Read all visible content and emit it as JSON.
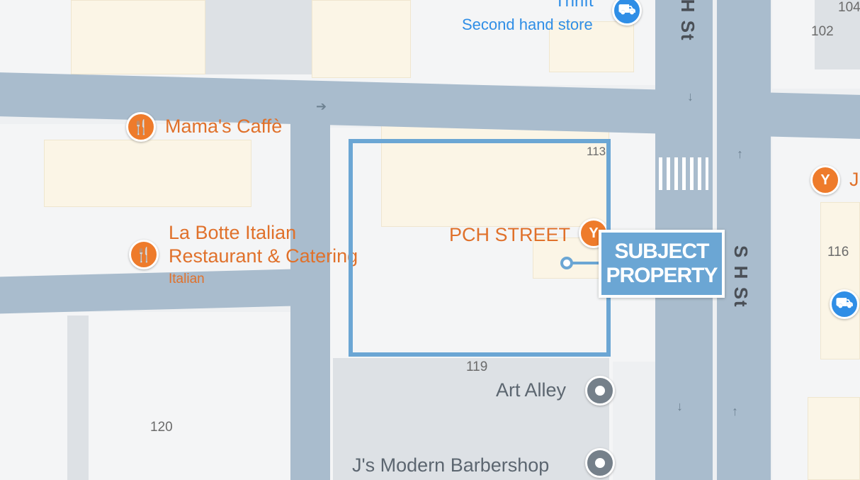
{
  "pois": {
    "thrift_name": "Thrift",
    "thrift_category": "Second hand store",
    "mamas": "Mama's Caffè",
    "labotte_line1": "La Botte Italian",
    "labotte_line2": "Restaurant & Catering",
    "labotte_category": "Italian",
    "pch": "PCH STREET",
    "art_alley": "Art Alley",
    "barbershop": "J's Modern Barbershop",
    "right_edge_letter": "J"
  },
  "streets": {
    "s_h_st": "S H St"
  },
  "lots": {
    "n102": "102",
    "n104": "104",
    "n113": "113",
    "n116": "116",
    "n119": "119",
    "n120": "120"
  },
  "subject": {
    "line1": "SUBJECT",
    "line2": "PROPERTY",
    "color": "#6ba6d4"
  },
  "icons": {
    "restaurant": "fork-knife-icon",
    "bar": "cocktail-icon",
    "shopping": "shopping-bag-icon",
    "place": "place-dot-icon"
  },
  "colors": {
    "road": "#a9bccd",
    "building": "#fbf5e6",
    "poi_orange": "#ee7b2b",
    "poi_blue": "#2f8ee6",
    "poi_gray": "#75808a"
  }
}
